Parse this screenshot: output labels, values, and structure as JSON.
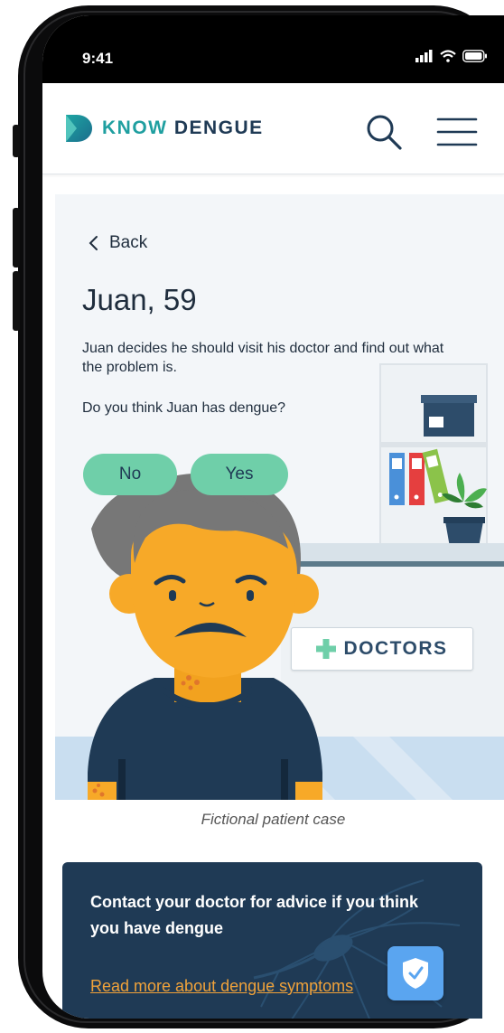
{
  "status_bar": {
    "time": "9:41"
  },
  "header": {
    "logo_know": "KNOW",
    "logo_dengue": "DENGUE"
  },
  "case": {
    "back_label": "Back",
    "title": "Juan, 59",
    "body": "Juan decides he should visit his doctor and find out what the problem is.",
    "question": "Do you think Juan has dengue?",
    "answer_no": "No",
    "answer_yes": "Yes",
    "sign_label": "DOCTORS"
  },
  "caption": "Fictional patient case",
  "banner": {
    "title": "Contact your doctor for advice if you think you have dengue",
    "link": "Read more about dengue symptoms"
  },
  "colors": {
    "accent_teal": "#1f9fa0",
    "navy": "#1f3a55",
    "button_green": "#6fcfa9",
    "link_orange": "#f0a23a"
  }
}
